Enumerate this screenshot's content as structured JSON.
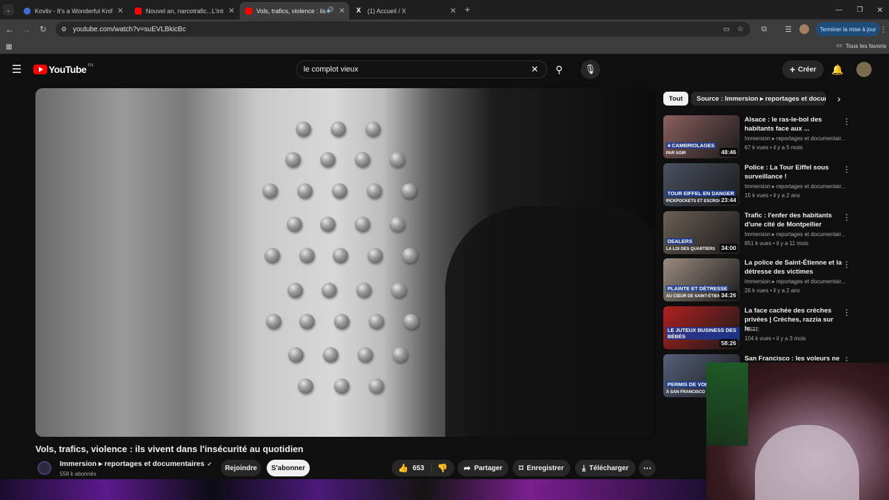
{
  "browser": {
    "tabs": [
      {
        "title": "Kovliv - It's a Wonderful Knife (",
        "active": false,
        "favicon_color": "#3c6ed8"
      },
      {
        "title": "Nouvel an, narcotrafic...L'interv",
        "active": false,
        "favicon_color": "#ff0000"
      },
      {
        "title": "Vols, trafics, violence : ils vi",
        "active": true,
        "favicon_color": "#ff0000"
      },
      {
        "title": "(1) Accueil / X",
        "active": false,
        "favicon_color": "#ffffff"
      }
    ],
    "url": "youtube.com/watch?v=suEVLBkicBc",
    "update_button": "Terminer la mise à jour",
    "bookmarks_all": "Tous les favoris"
  },
  "youtube": {
    "logo_text": "YouTube",
    "logo_region": "FR",
    "search_value": "le complot vieux",
    "create_label": "Créer",
    "video": {
      "title": "Vols, trafics, violence : ils vivent dans l'insécurité au quotidien",
      "channel": "Immersion ▸ reportages et documentaires",
      "subscribers": "558 k abonnés",
      "join_label": "Rejoindre",
      "subscribe_label": "S'abonner",
      "likes": "653",
      "share_label": "Partager",
      "save_label": "Enregistrer",
      "download_label": "Télécharger"
    },
    "chips": [
      "Tout",
      "Source : Immersion ▸ reportages et docume"
    ],
    "recommendations": [
      {
        "title": "Alsace : le ras-le-bol des habitants face aux ...",
        "channel": "Immersion ▸ reportages et documentair...",
        "meta": "67 k vues • il y a 5 mois",
        "duration": "48:46",
        "thumb_label": "4 CAMBRIOLAGES",
        "thumb_sub": "PAR SOIR",
        "thumb_color": "#8b5f5f"
      },
      {
        "title": "Police : La Tour Eiffel sous surveillance !",
        "channel": "Immersion ▸ reportages et documentair...",
        "meta": "15 k vues • il y a 2 ans",
        "duration": "23:44",
        "thumb_label": "TOUR EIFFEL EN DANGER",
        "thumb_sub": "PICKPOCKETS ET ESCROCS",
        "thumb_color": "#4a5260"
      },
      {
        "title": "Trafic : l'enfer des habitants d'une cité de Montpellier",
        "channel": "Immersion ▸ reportages et documentair...",
        "meta": "851 k vues • il y a 11 mois",
        "duration": "34:00",
        "thumb_label": "DEALERS",
        "thumb_sub": "LA LOI DES QUARTIERS",
        "thumb_color": "#6b6055"
      },
      {
        "title": "La police de Saint-Étienne et la détresse des victimes",
        "channel": "Immersion ▸ reportages et documentair...",
        "meta": "26 k vues • il y a 2 ans",
        "duration": "34:26",
        "thumb_label": "PLAINTE ET DÉTRESSE",
        "thumb_sub": "AU CŒUR DE SAINT-ÉTIENNE",
        "thumb_color": "#9a8b80"
      },
      {
        "title": "La face cachée des crèches privées | Crèches, razzia sur le...",
        "channel": "ARTE",
        "meta": "104 k vues • il y a 3 mois",
        "duration": "58:26",
        "thumb_label": "LE JUTEUX BUSINESS DES BÉBÉS",
        "thumb_sub": "",
        "thumb_color": "#b02020"
      },
      {
        "title": "San Francisco : les voleurs ne",
        "channel": "",
        "meta": "",
        "duration": "",
        "thumb_label": "PERMIS DE VOL",
        "thumb_sub": "À SAN FRANCISCO",
        "thumb_color": "#55607a"
      }
    ]
  }
}
